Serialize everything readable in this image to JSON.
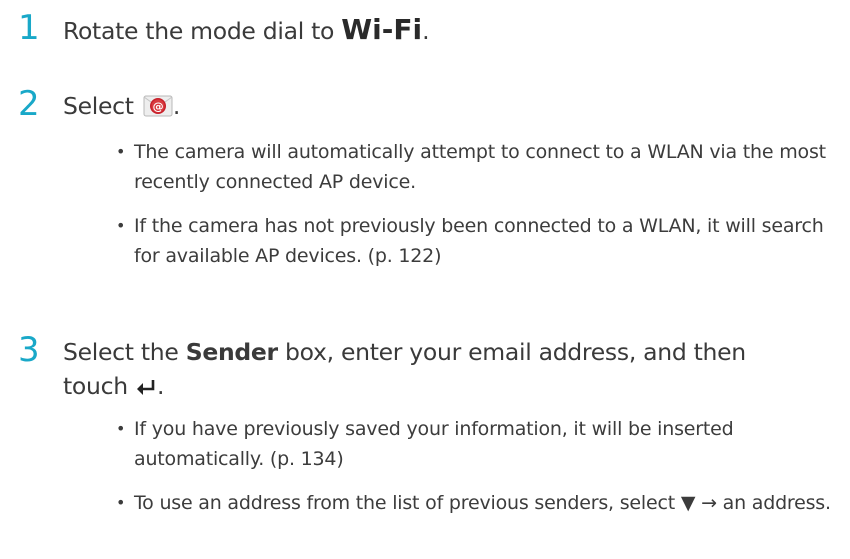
{
  "steps": [
    {
      "number": "1",
      "text_before": "Rotate the mode dial to ",
      "wifi_label": "Wi-Fi",
      "text_after": "."
    },
    {
      "number": "2",
      "text_before": "Select ",
      "icon": "email-icon",
      "text_after": ".",
      "bullets": [
        "The camera will automatically attempt to connect to a WLAN via the most recently connected AP device.",
        "If the camera has not previously been connected to a WLAN, it will search for available AP devices. (p. 122)"
      ]
    },
    {
      "number": "3",
      "text_before": "Select the ",
      "bold_word": "Sender",
      "text_mid": " box, enter your email address, and then",
      "line2_before": "touch ",
      "icon": "enter-icon",
      "line2_after": ".",
      "bullets": [
        "If you have previously saved your information, it will be inserted automatically. (p. 134)",
        "To use an address from the list of previous senders, select ▼ → an address."
      ]
    }
  ],
  "colors": {
    "accent": "#19a8c8",
    "text": "#3c3c3c",
    "icon_red": "#c8202a"
  }
}
